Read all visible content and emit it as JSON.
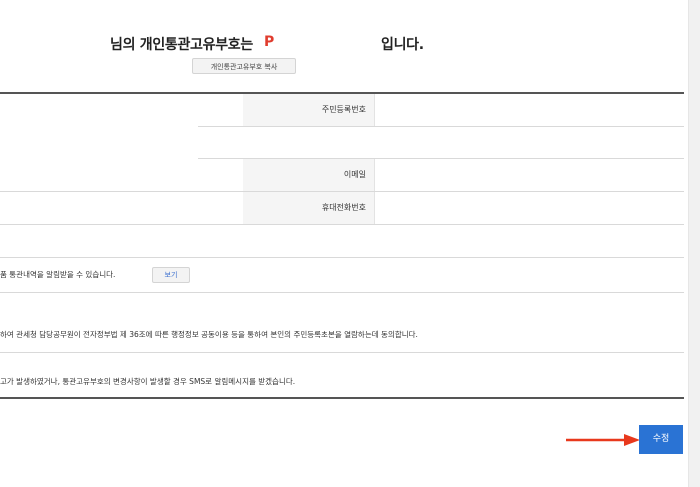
{
  "header": {
    "title_prefix": "님의 개인통관고유부호는",
    "code_prefix": "P",
    "title_suffix": "입니다.",
    "copy_button": "개인통관고유부호 복사"
  },
  "form": {
    "labels": {
      "resident_number": "주민등록번호",
      "email": "이메일",
      "mobile": "휴대전화번호"
    }
  },
  "notices": {
    "customs_history": "품 통관내역을 알림받을 수 있습니다.",
    "view_button": "보기",
    "consent_resident": "하여 관세청 담당공무원이 전자정부법 제 36조에 따른 행정정보 공동이용 등을 통하여 본인의 주민등록초본을 열람하는데 동의합니다.",
    "consent_sms": "고가 발생하였거나, 통관고유부호의 변경사항이 발생할 경우 SMS로 알림메시지를 받겠습니다."
  },
  "actions": {
    "submit": "수정"
  },
  "colors": {
    "accent": "#2a73d4",
    "code": "#e03c2e",
    "arrow": "#e8381c"
  }
}
